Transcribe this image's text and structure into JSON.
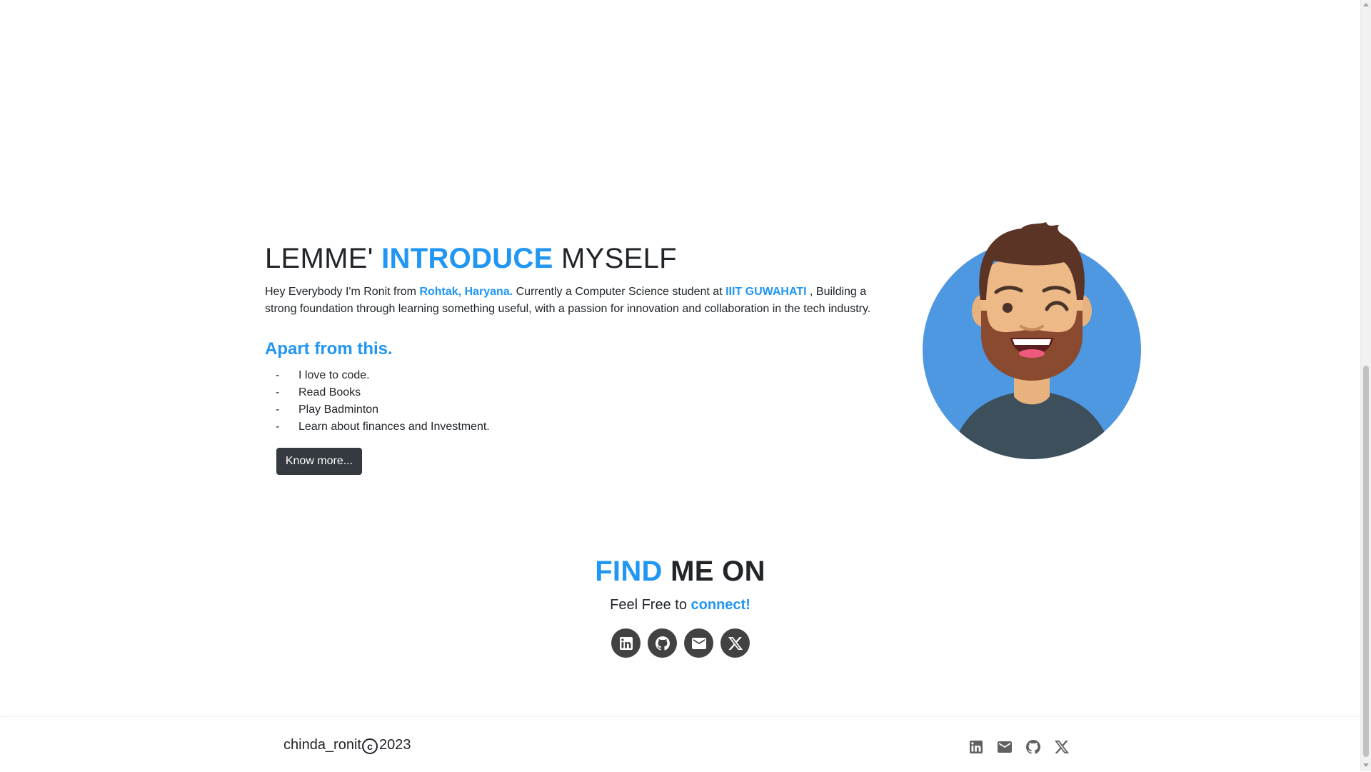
{
  "intro": {
    "title_pre": "LEMME'",
    "title_accent": "INTRODUCE",
    "title_post": "MYSELF",
    "text_1": "Hey Everybody I'm Ronit from ",
    "location": "Rohtak, Haryana.",
    "text_2": " Currently a Computer Science student at ",
    "college": "IIIT GUWAHATI",
    "text_3": " , Building a strong foundation through learning something useful, with a passion for innovation and collaboration in the tech industry.",
    "apart_title": "Apart from this.",
    "hobbies": [
      "I love to code.",
      "Read Books",
      "Play Badminton",
      "Learn about finances and Investment."
    ],
    "button_label": "Know more..."
  },
  "find_me": {
    "title_accent": "FIND",
    "title_rest": "ME ON",
    "sub_pre": "Feel Free to ",
    "sub_accent": "connect!",
    "icons": [
      "linkedin-icon",
      "github-icon",
      "mail-icon",
      "x-icon"
    ]
  },
  "footer": {
    "handle": "chinda_ronit",
    "copyright_symbol": "c",
    "year": "2023",
    "icons": [
      "linkedin-icon",
      "mail-icon",
      "github-icon",
      "x-icon"
    ]
  },
  "colors": {
    "accent": "#2196f3",
    "button_bg": "#343a40",
    "social_bg": "#424242",
    "avatar_bg": "#4e97e1"
  }
}
